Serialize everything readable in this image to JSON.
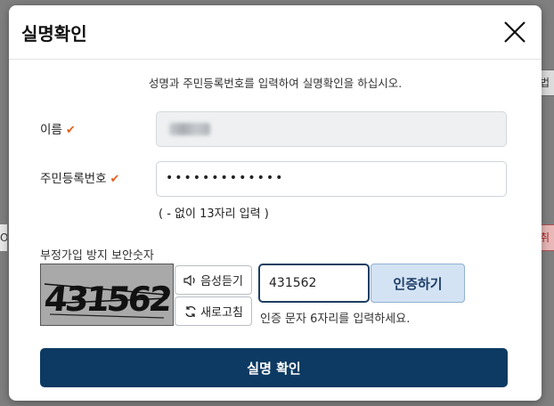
{
  "background": {
    "right_tab_top": "법인",
    "right_tab_bottom": "취소",
    "left_chip": "O"
  },
  "modal": {
    "title": "실명확인",
    "instruction": "성명과 주민등록번호를 입력하여 실명확인을 하십시오.",
    "name_label": "이름",
    "rrn_label": "주민등록번호",
    "check_mark": "✔",
    "rrn_value": "•••••••••••••",
    "rrn_hint": "( - 없이 13자리 입력 )",
    "captcha_title": "부정가입 방지 보안숫자",
    "captcha_text": "431562",
    "audio_button": "음성듣기",
    "refresh_button": "새로고침",
    "code_value": "431562",
    "verify_button": "인증하기",
    "code_hint": "인증 문자 6자리를 입력하세요.",
    "confirm_button": "실명 확인"
  },
  "colors": {
    "primary": "#0c3a63",
    "check": "#e5601d",
    "verify_bg": "#d3e3f4"
  }
}
